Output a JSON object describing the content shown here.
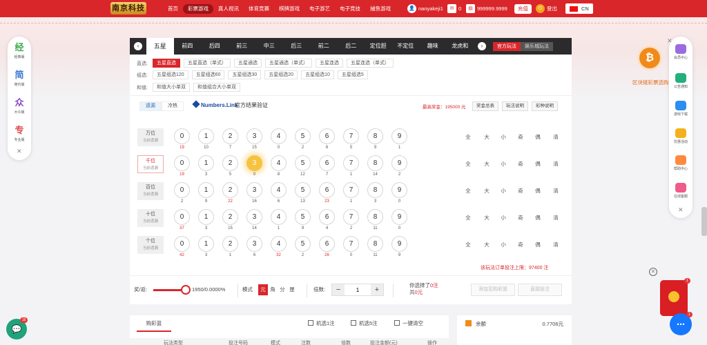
{
  "header": {
    "logo": "南京科技",
    "nav": [
      "首页",
      "彩票游戏",
      "真人视讯",
      "体育竞赛",
      "棋牌游戏",
      "电子游艺",
      "电子竞技",
      "捕鱼游戏"
    ],
    "nav_active": 1,
    "username": "nanyakeji1",
    "messages": "0",
    "balance": "999999.9999",
    "recharge": "充值",
    "logout": "登出",
    "lang": "CN"
  },
  "tabs": [
    "五星",
    "前四",
    "后四",
    "前三",
    "中三",
    "后三",
    "前二",
    "后二",
    "定位胆",
    "不定位",
    "趣味",
    "龙虎和"
  ],
  "tab_active": 0,
  "play_mode": {
    "official": "官方玩法",
    "entertainment": "娱乐城玩法"
  },
  "groups": [
    {
      "label": "直选:",
      "items": [
        "五星直选",
        "五星直选（单式）",
        "五星通选",
        "五星通选（单式）",
        "五星连选",
        "五星连选（单式）"
      ],
      "active": 0
    },
    {
      "label": "组选:",
      "items": [
        "五星组选120",
        "五星组选60",
        "五星组选30",
        "五星组选20",
        "五星组选10",
        "五星组选5"
      ],
      "active": -1
    },
    {
      "label": "和值:",
      "items": [
        "和值大小单双",
        "和值组合大小单双"
      ],
      "active": -1
    }
  ],
  "toolbar": {
    "hot": "遗漏",
    "cold": "冷热",
    "numbers_link": "Numbers.Link",
    "verify": "官方结果验证",
    "max_prize": "最高奖金：195000 元",
    "buttons": [
      "奖金总表",
      "玩法说明",
      "彩种说明"
    ]
  },
  "rows": [
    {
      "pos": "万位",
      "sub": "当前遗漏",
      "selected": false,
      "highlight": -1,
      "miss": [
        "19",
        "10",
        "7",
        "15",
        "0",
        "2",
        "6",
        "5",
        "9",
        "1"
      ]
    },
    {
      "pos": "千位",
      "sub": "当前遗漏",
      "selected": true,
      "highlight": 3,
      "miss": [
        "19",
        "3",
        "5",
        "0",
        "8",
        "12",
        "7",
        "1",
        "14",
        "2"
      ]
    },
    {
      "pos": "百位",
      "sub": "当前遗漏",
      "selected": false,
      "highlight": -1,
      "miss": [
        "2",
        "9",
        "22",
        "16",
        "6",
        "13",
        "23",
        "1",
        "3",
        "0"
      ]
    },
    {
      "pos": "十位",
      "sub": "当前遗漏",
      "selected": false,
      "highlight": -1,
      "miss": [
        "37",
        "3",
        "15",
        "14",
        "1",
        "9",
        "4",
        "2",
        "11",
        "0"
      ]
    },
    {
      "pos": "个位",
      "sub": "当前遗漏",
      "selected": false,
      "highlight": -1,
      "miss": [
        "42",
        "3",
        "1",
        "6",
        "32",
        "2",
        "26",
        "0",
        "11",
        "9"
      ]
    }
  ],
  "digits": [
    "0",
    "1",
    "2",
    "3",
    "4",
    "5",
    "6",
    "7",
    "8",
    "9"
  ],
  "quick": [
    "全",
    "大",
    "小",
    "奇",
    "偶",
    "清"
  ],
  "limit_text": "该玩法订单投注上限：97400 注",
  "bet": {
    "rebate_label": "奖/返:",
    "rebate_value": "1950/0.0000%",
    "mode_label": "模式",
    "modes": [
      "元",
      "角",
      "分",
      "厘"
    ],
    "mode_active": 0,
    "multiple_label": "倍数:",
    "multiple_value": "1",
    "minus": "−",
    "plus": "+",
    "selected_text_a": "你选择了",
    "selected_count": "0注",
    "selected_text_b": "共",
    "selected_amount": "0元",
    "add_cart": "添加至购彩篮",
    "quick_bet": "直接投注"
  },
  "cart": {
    "tab": "购彩篮",
    "random1": "机选1注",
    "random5": "机选5注",
    "clear": "一键清空",
    "columns": [
      "玩法类型",
      "投注号码",
      "模式",
      "注数",
      "倍数",
      "投注金额(元)",
      "操作"
    ]
  },
  "balance_panel": {
    "label": "余额",
    "value": "0.7706元"
  },
  "left_sidebar": [
    {
      "icon": "经",
      "label": "经典版",
      "color": "#3aa84a"
    },
    {
      "icon": "简",
      "label": "简约版",
      "color": "#3b7ad6"
    },
    {
      "icon": "众",
      "label": "大众版",
      "color": "#8a47c8"
    },
    {
      "icon": "专",
      "label": "专业版",
      "color": "#e0474a"
    }
  ],
  "right_sidebar": [
    {
      "label": "会员中心",
      "color": "#9b6ce0"
    },
    {
      "label": "公告通知",
      "color": "#22b07d"
    },
    {
      "label": "游戏下载",
      "color": "#2c8ef0"
    },
    {
      "label": "优惠活动",
      "color": "#f3b21d"
    },
    {
      "label": "帮助中心",
      "color": "#ff8a3d"
    },
    {
      "label": "在线客服",
      "color": "#ef5b8a"
    }
  ],
  "btc": {
    "symbol": "₿",
    "label": "区块链彩票选购"
  },
  "chat_badge": "18",
  "redpacket_badge": "1",
  "help_badge": "1",
  "colors": {
    "brand": "#d9262a",
    "dark_tab": "#2b2b2d",
    "highlight": "#f6c341"
  }
}
